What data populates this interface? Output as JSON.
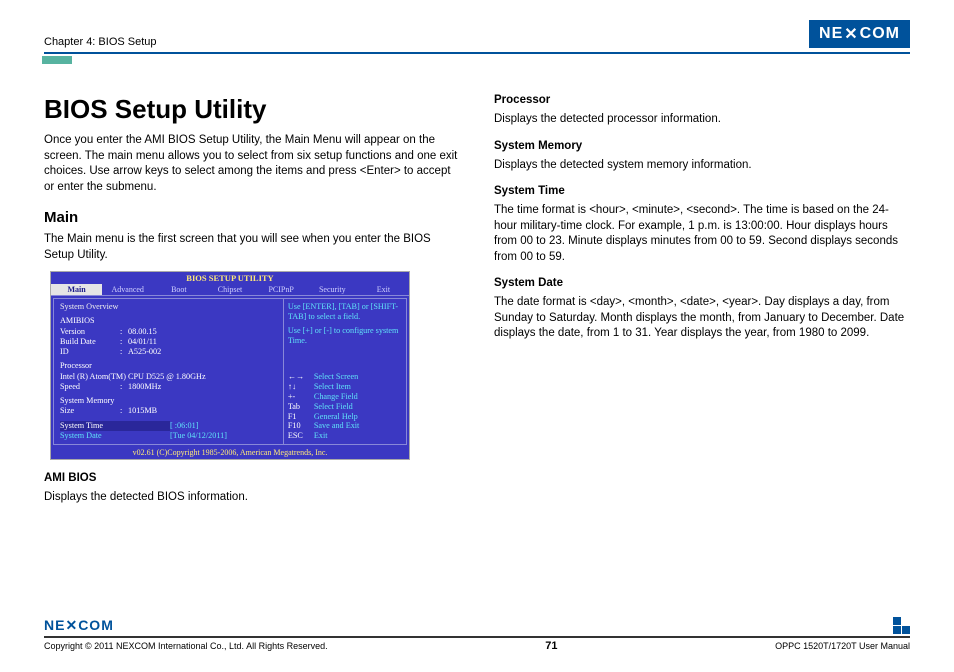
{
  "header": {
    "chapter": "Chapter 4: BIOS Setup",
    "brand": "NE COM",
    "brand_x": "✕"
  },
  "left": {
    "h1": "BIOS Setup Utility",
    "intro": "Once you enter the AMI BIOS Setup Utility, the Main Menu will appear on the screen. The main menu allows you to select from six setup functions and one exit choices. Use arrow keys to select among the items and press <Enter> to accept or enter the submenu.",
    "h2": "Main",
    "main_p": "The Main menu is the first screen that you will see when you enter the BIOS Setup Utility.",
    "ami_h": "AMI BIOS",
    "ami_p": "Displays the detected BIOS information."
  },
  "bios": {
    "title": "BIOS SETUP UTILITY",
    "menu": [
      "Main",
      "Advanced",
      "Boot",
      "Chipset",
      "PCIPnP",
      "Security",
      "Exit"
    ],
    "overview": "System Overview",
    "amibios_h": "AMIBIOS",
    "rows": {
      "version_k": "Version",
      "version_v": "08.00.15",
      "build_k": "Build Date",
      "build_v": "04/01/11",
      "id_k": "ID",
      "id_v": "A525-002"
    },
    "proc_h": "Processor",
    "proc_name": "Intel (R) Atom(TM) CPU D525 @ 1.80GHz",
    "speed_k": "Speed",
    "speed_v": "1800MHz",
    "mem_h": "System Memory",
    "size_k": "Size",
    "size_v": "1015MB",
    "time_k": "System Time",
    "time_v": "[      :06:01]",
    "date_k": "System Date",
    "date_v": "[Tue 04/12/2011]",
    "help1": "Use [ENTER], [TAB] or [SHIFT-TAB] to select a field.",
    "help2": "Use [+] or [-] to configure system Time.",
    "keys": [
      {
        "k": "←→",
        "l": "Select Screen"
      },
      {
        "k": "↑↓",
        "l": "Select Item"
      },
      {
        "k": "+-",
        "l": "Change Field"
      },
      {
        "k": "Tab",
        "l": "Select Field"
      },
      {
        "k": "F1",
        "l": "General Help"
      },
      {
        "k": "F10",
        "l": "Save and Exit"
      },
      {
        "k": "ESC",
        "l": "Exit"
      }
    ],
    "foot": "v02.61 (C)Copyright 1985-2006, American Megatrends, Inc."
  },
  "right": {
    "proc_h": "Processor",
    "proc_p": "Displays the detected processor information.",
    "mem_h": "System Memory",
    "mem_p": "Displays the detected system memory information.",
    "time_h": "System Time",
    "time_p": "The time format is <hour>, <minute>, <second>. The time is based on the 24-hour military-time clock. For example, 1 p.m. is 13:00:00. Hour displays hours from 00 to 23. Minute displays minutes from 00 to 59. Second displays seconds from 00 to 59.",
    "date_h": "System Date",
    "date_p": "The date format is <day>, <month>, <date>, <year>. Day displays a day, from Sunday to Saturday. Month displays the month, from January to December. Date displays the date, from 1 to 31. Year displays the year, from 1980 to 2099."
  },
  "footer": {
    "copy": "Copyright © 2011 NEXCOM International Co., Ltd. All Rights Reserved.",
    "page": "71",
    "doc": "OPPC 1520T/1720T User Manual"
  }
}
